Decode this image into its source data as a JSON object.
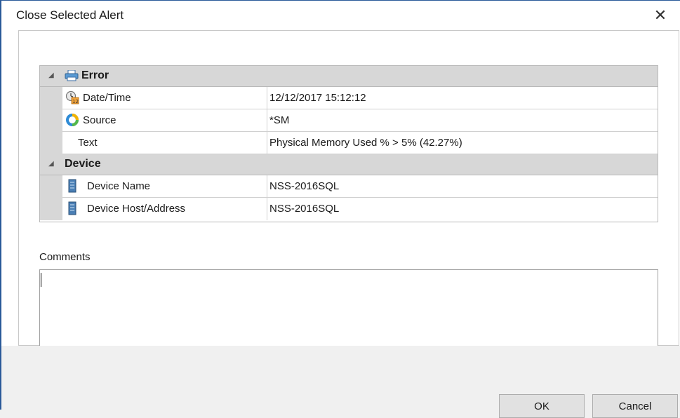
{
  "window": {
    "title": "Close Selected Alert",
    "close_glyph": "✕"
  },
  "grid": {
    "categories": [
      {
        "label": "Error",
        "icon": "printer-icon",
        "expanded": true,
        "properties": [
          {
            "name": "Date/Time",
            "value": "12/12/2017 15:12:12",
            "icon": "calendar-clock-icon"
          },
          {
            "name": "Source",
            "value": "*SM",
            "icon": "source-ring-icon"
          },
          {
            "name": "Text",
            "value": "Physical Memory Used %  > 5% (42.27%)",
            "icon": ""
          }
        ]
      },
      {
        "label": "Device",
        "icon": "",
        "expanded": true,
        "properties": [
          {
            "name": "Device Name",
            "value": "NSS-2016SQL",
            "icon": "server-icon"
          },
          {
            "name": "Device Host/Address",
            "value": "NSS-2016SQL",
            "icon": "server-icon"
          }
        ]
      }
    ]
  },
  "comments": {
    "label": "Comments",
    "value": ""
  },
  "buttons": {
    "ok_label": "OK",
    "cancel_label": "Cancel"
  },
  "colors": {
    "window_border": "#2a5a99",
    "category_bg": "#d7d7d7",
    "button_bg": "#e1e1e1"
  }
}
